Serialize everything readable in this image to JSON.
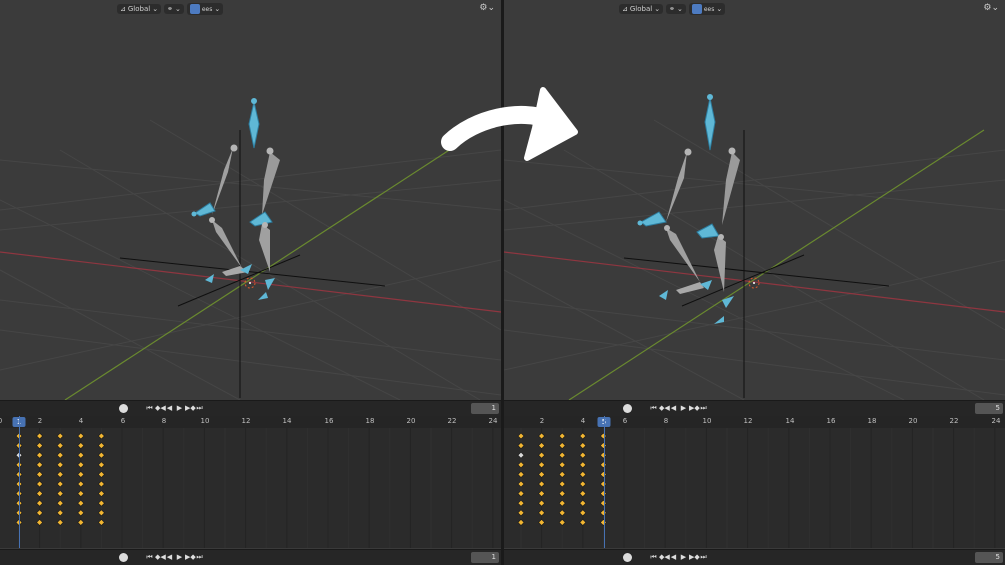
{
  "colors": {
    "keyframe": "#f2b632",
    "keyframe_selected": "#d9d9d9",
    "accent": "#4772b3",
    "bone": "#9a9a9a",
    "bone_selected": "#5fb8d6",
    "x_axis": "#9b3a45",
    "y_axis": "#6b8a35"
  },
  "left_panel": {
    "header": {
      "transform": "Global",
      "proportional_label": "ees"
    },
    "playback": {
      "icons": [
        "record-icon",
        "jump-start-icon",
        "prev-key-icon",
        "play-reverse-icon",
        "play-icon",
        "next-key-icon",
        "jump-end-icon"
      ],
      "current_frame": "1"
    },
    "timeline": {
      "ruler_labels": [
        "0",
        "2",
        "4",
        "6",
        "8",
        "10",
        "12",
        "14",
        "16",
        "18",
        "20",
        "22",
        "24"
      ],
      "current_frame_badge": "1",
      "current_frame": 1
    }
  },
  "right_panel": {
    "header": {
      "transform": "Global",
      "proportional_label": "ees"
    },
    "playback": {
      "icons": [
        "record-icon",
        "jump-start-icon",
        "prev-key-icon",
        "play-reverse-icon",
        "play-icon",
        "next-key-icon",
        "jump-end-icon"
      ],
      "current_frame": "5"
    },
    "timeline": {
      "ruler_labels": [
        "2",
        "4",
        "6",
        "8",
        "10",
        "12",
        "14",
        "16",
        "18",
        "20",
        "22",
        "24"
      ],
      "current_frame_badge": "5",
      "current_frame": 5
    }
  },
  "keyframes": {
    "frames": [
      1,
      2,
      3,
      4,
      5
    ],
    "rows": 10,
    "selected_first_column_rows": [
      2
    ]
  },
  "transition_arrow": "arrow-icon"
}
